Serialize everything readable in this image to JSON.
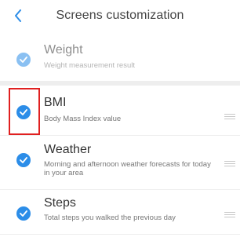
{
  "header": {
    "title": "Screens customization",
    "back_icon": "chevron-left-icon",
    "accent": "#2c8de8"
  },
  "items": [
    {
      "title": "Weight",
      "subtitle": "Weight measurement result",
      "checked": true,
      "dimmed": true
    },
    {
      "title": "BMI",
      "subtitle": "Body Mass Index value",
      "checked": true,
      "dimmed": false
    },
    {
      "title": "Weather",
      "subtitle": "Morning and afternoon weather forecasts for today in your area",
      "checked": true,
      "dimmed": false
    },
    {
      "title": "Steps",
      "subtitle": "Total steps you walked the previous day",
      "checked": true,
      "dimmed": false
    }
  ],
  "colors": {
    "check": "#2c8de8",
    "highlight": "#e02020"
  }
}
